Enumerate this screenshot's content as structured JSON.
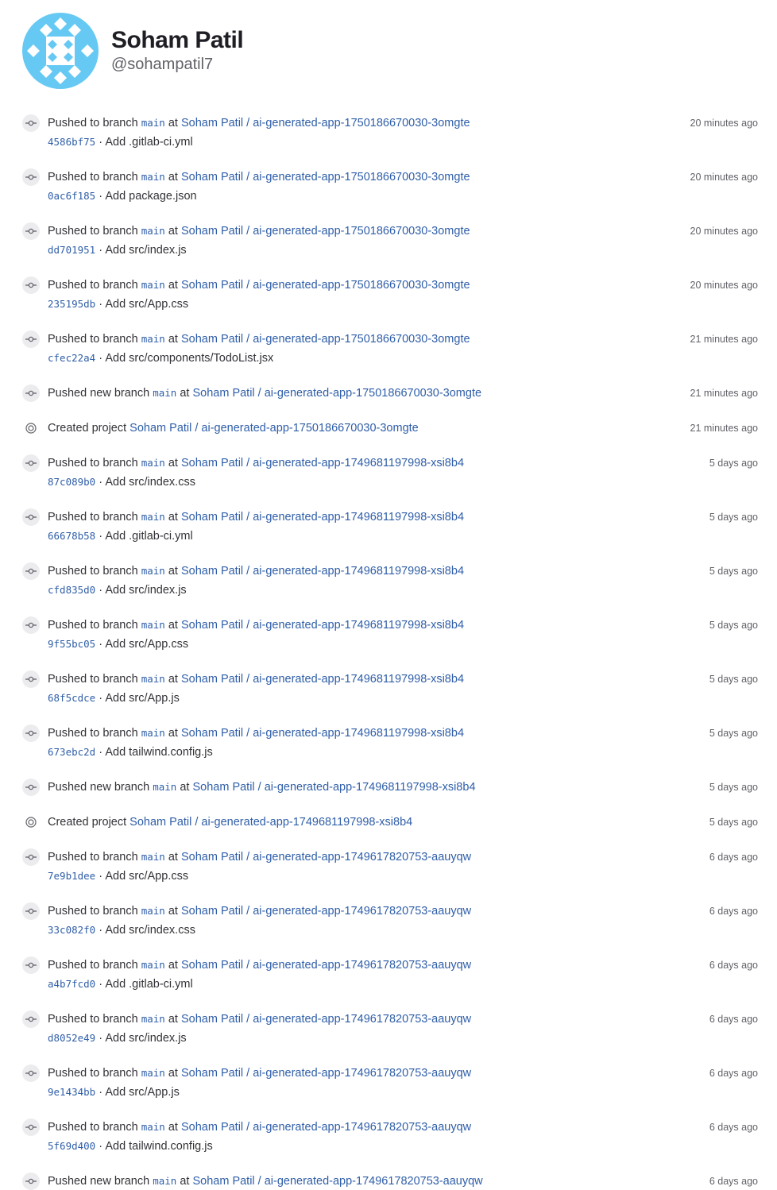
{
  "profile": {
    "name": "Soham Patil",
    "username": "@sohampatil7"
  },
  "strings": {
    "at": "at",
    "dot": "·"
  },
  "events": [
    {
      "kind": "push",
      "action": "Pushed to branch",
      "branch": "main",
      "project": "Soham Patil / ai-generated-app-1750186670030-3omgte",
      "sha": "4586bf75",
      "message": "Add .gitlab-ci.yml",
      "time": "20 minutes ago"
    },
    {
      "kind": "push",
      "action": "Pushed to branch",
      "branch": "main",
      "project": "Soham Patil / ai-generated-app-1750186670030-3omgte",
      "sha": "0ac6f185",
      "message": "Add package.json",
      "time": "20 minutes ago"
    },
    {
      "kind": "push",
      "action": "Pushed to branch",
      "branch": "main",
      "project": "Soham Patil / ai-generated-app-1750186670030-3omgte",
      "sha": "dd701951",
      "message": "Add src/index.js",
      "time": "20 minutes ago"
    },
    {
      "kind": "push",
      "action": "Pushed to branch",
      "branch": "main",
      "project": "Soham Patil / ai-generated-app-1750186670030-3omgte",
      "sha": "235195db",
      "message": "Add src/App.css",
      "time": "20 minutes ago"
    },
    {
      "kind": "push",
      "action": "Pushed to branch",
      "branch": "main",
      "project": "Soham Patil / ai-generated-app-1750186670030-3omgte",
      "sha": "cfec22a4",
      "message": "Add src/components/TodoList.jsx",
      "time": "21 minutes ago"
    },
    {
      "kind": "newbranch",
      "action": "Pushed new branch",
      "branch": "main",
      "project": "Soham Patil / ai-generated-app-1750186670030-3omgte",
      "time": "21 minutes ago"
    },
    {
      "kind": "created",
      "action": "Created project",
      "project": "Soham Patil / ai-generated-app-1750186670030-3omgte",
      "time": "21 minutes ago"
    },
    {
      "kind": "push",
      "action": "Pushed to branch",
      "branch": "main",
      "project": "Soham Patil / ai-generated-app-1749681197998-xsi8b4",
      "sha": "87c089b0",
      "message": "Add src/index.css",
      "time": "5 days ago"
    },
    {
      "kind": "push",
      "action": "Pushed to branch",
      "branch": "main",
      "project": "Soham Patil / ai-generated-app-1749681197998-xsi8b4",
      "sha": "66678b58",
      "message": "Add .gitlab-ci.yml",
      "time": "5 days ago"
    },
    {
      "kind": "push",
      "action": "Pushed to branch",
      "branch": "main",
      "project": "Soham Patil / ai-generated-app-1749681197998-xsi8b4",
      "sha": "cfd835d0",
      "message": "Add src/index.js",
      "time": "5 days ago"
    },
    {
      "kind": "push",
      "action": "Pushed to branch",
      "branch": "main",
      "project": "Soham Patil / ai-generated-app-1749681197998-xsi8b4",
      "sha": "9f55bc05",
      "message": "Add src/App.css",
      "time": "5 days ago"
    },
    {
      "kind": "push",
      "action": "Pushed to branch",
      "branch": "main",
      "project": "Soham Patil / ai-generated-app-1749681197998-xsi8b4",
      "sha": "68f5cdce",
      "message": "Add src/App.js",
      "time": "5 days ago"
    },
    {
      "kind": "push",
      "action": "Pushed to branch",
      "branch": "main",
      "project": "Soham Patil / ai-generated-app-1749681197998-xsi8b4",
      "sha": "673ebc2d",
      "message": "Add tailwind.config.js",
      "time": "5 days ago"
    },
    {
      "kind": "newbranch",
      "action": "Pushed new branch",
      "branch": "main",
      "project": "Soham Patil / ai-generated-app-1749681197998-xsi8b4",
      "time": "5 days ago"
    },
    {
      "kind": "created",
      "action": "Created project",
      "project": "Soham Patil / ai-generated-app-1749681197998-xsi8b4",
      "time": "5 days ago"
    },
    {
      "kind": "push",
      "action": "Pushed to branch",
      "branch": "main",
      "project": "Soham Patil / ai-generated-app-1749617820753-aauyqw",
      "sha": "7e9b1dee",
      "message": "Add src/App.css",
      "time": "6 days ago"
    },
    {
      "kind": "push",
      "action": "Pushed to branch",
      "branch": "main",
      "project": "Soham Patil / ai-generated-app-1749617820753-aauyqw",
      "sha": "33c082f0",
      "message": "Add src/index.css",
      "time": "6 days ago"
    },
    {
      "kind": "push",
      "action": "Pushed to branch",
      "branch": "main",
      "project": "Soham Patil / ai-generated-app-1749617820753-aauyqw",
      "sha": "a4b7fcd0",
      "message": "Add .gitlab-ci.yml",
      "time": "6 days ago"
    },
    {
      "kind": "push",
      "action": "Pushed to branch",
      "branch": "main",
      "project": "Soham Patil / ai-generated-app-1749617820753-aauyqw",
      "sha": "d8052e49",
      "message": "Add src/index.js",
      "time": "6 days ago"
    },
    {
      "kind": "push",
      "action": "Pushed to branch",
      "branch": "main",
      "project": "Soham Patil / ai-generated-app-1749617820753-aauyqw",
      "sha": "9e1434bb",
      "message": "Add src/App.js",
      "time": "6 days ago"
    },
    {
      "kind": "push",
      "action": "Pushed to branch",
      "branch": "main",
      "project": "Soham Patil / ai-generated-app-1749617820753-aauyqw",
      "sha": "5f69d400",
      "message": "Add tailwind.config.js",
      "time": "6 days ago"
    },
    {
      "kind": "newbranch",
      "action": "Pushed new branch",
      "branch": "main",
      "project": "Soham Patil / ai-generated-app-1749617820753-aauyqw",
      "time": "6 days ago"
    }
  ]
}
